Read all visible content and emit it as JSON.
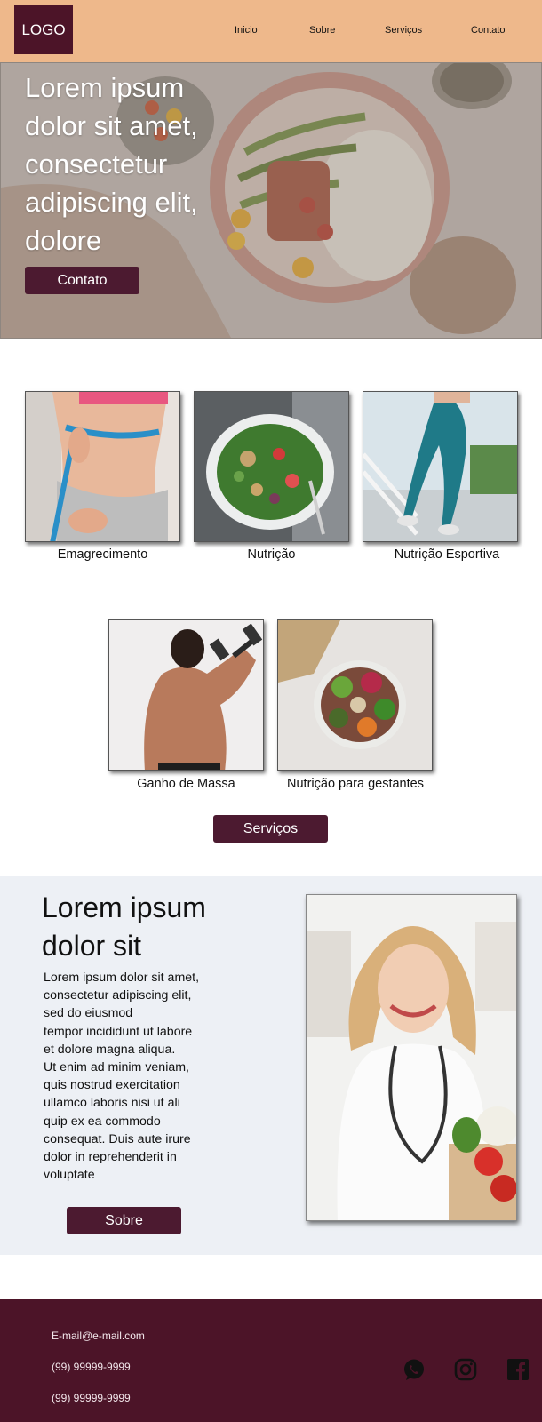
{
  "header": {
    "logo": "LOGO",
    "nav": [
      "Inicio",
      "Sobre",
      "Serviços",
      "Contato"
    ]
  },
  "hero": {
    "title": "Lorem ipsum dolor sit amet, consectetur adipiscing elit, dolore",
    "button_label": "Contato"
  },
  "services": {
    "items": [
      "Emagrecimento",
      "Nutrição",
      "Nutrição Esportiva",
      "Ganho de Massa",
      "Nutrição para gestantes"
    ],
    "button_label": "Serviços"
  },
  "about": {
    "title": "Lorem ipsum dolor sit",
    "text": "Lorem ipsum dolor sit amet,\nconsectetur adipiscing elit,\nsed do eiusmod\ntempor incididunt ut labore\n et dolore magna aliqua.\nUt enim ad minim veniam,\nquis nostrud exercitation\nullamco laboris nisi ut ali\nquip ex ea commodo\nconsequat. Duis aute irure\ndolor in reprehenderit in\nvoluptate",
    "button_label": "Sobre"
  },
  "footer": {
    "email": "E-mail@e-mail.com",
    "phone1": "(99) 99999-9999",
    "phone2": "(99) 99999-9999",
    "social_icons": [
      "whatsapp-icon",
      "instagram-icon",
      "facebook-icon"
    ]
  },
  "colors": {
    "header_bg": "#eeb88b",
    "brand_dark": "#4c1428",
    "about_bg": "#edf0f5"
  }
}
